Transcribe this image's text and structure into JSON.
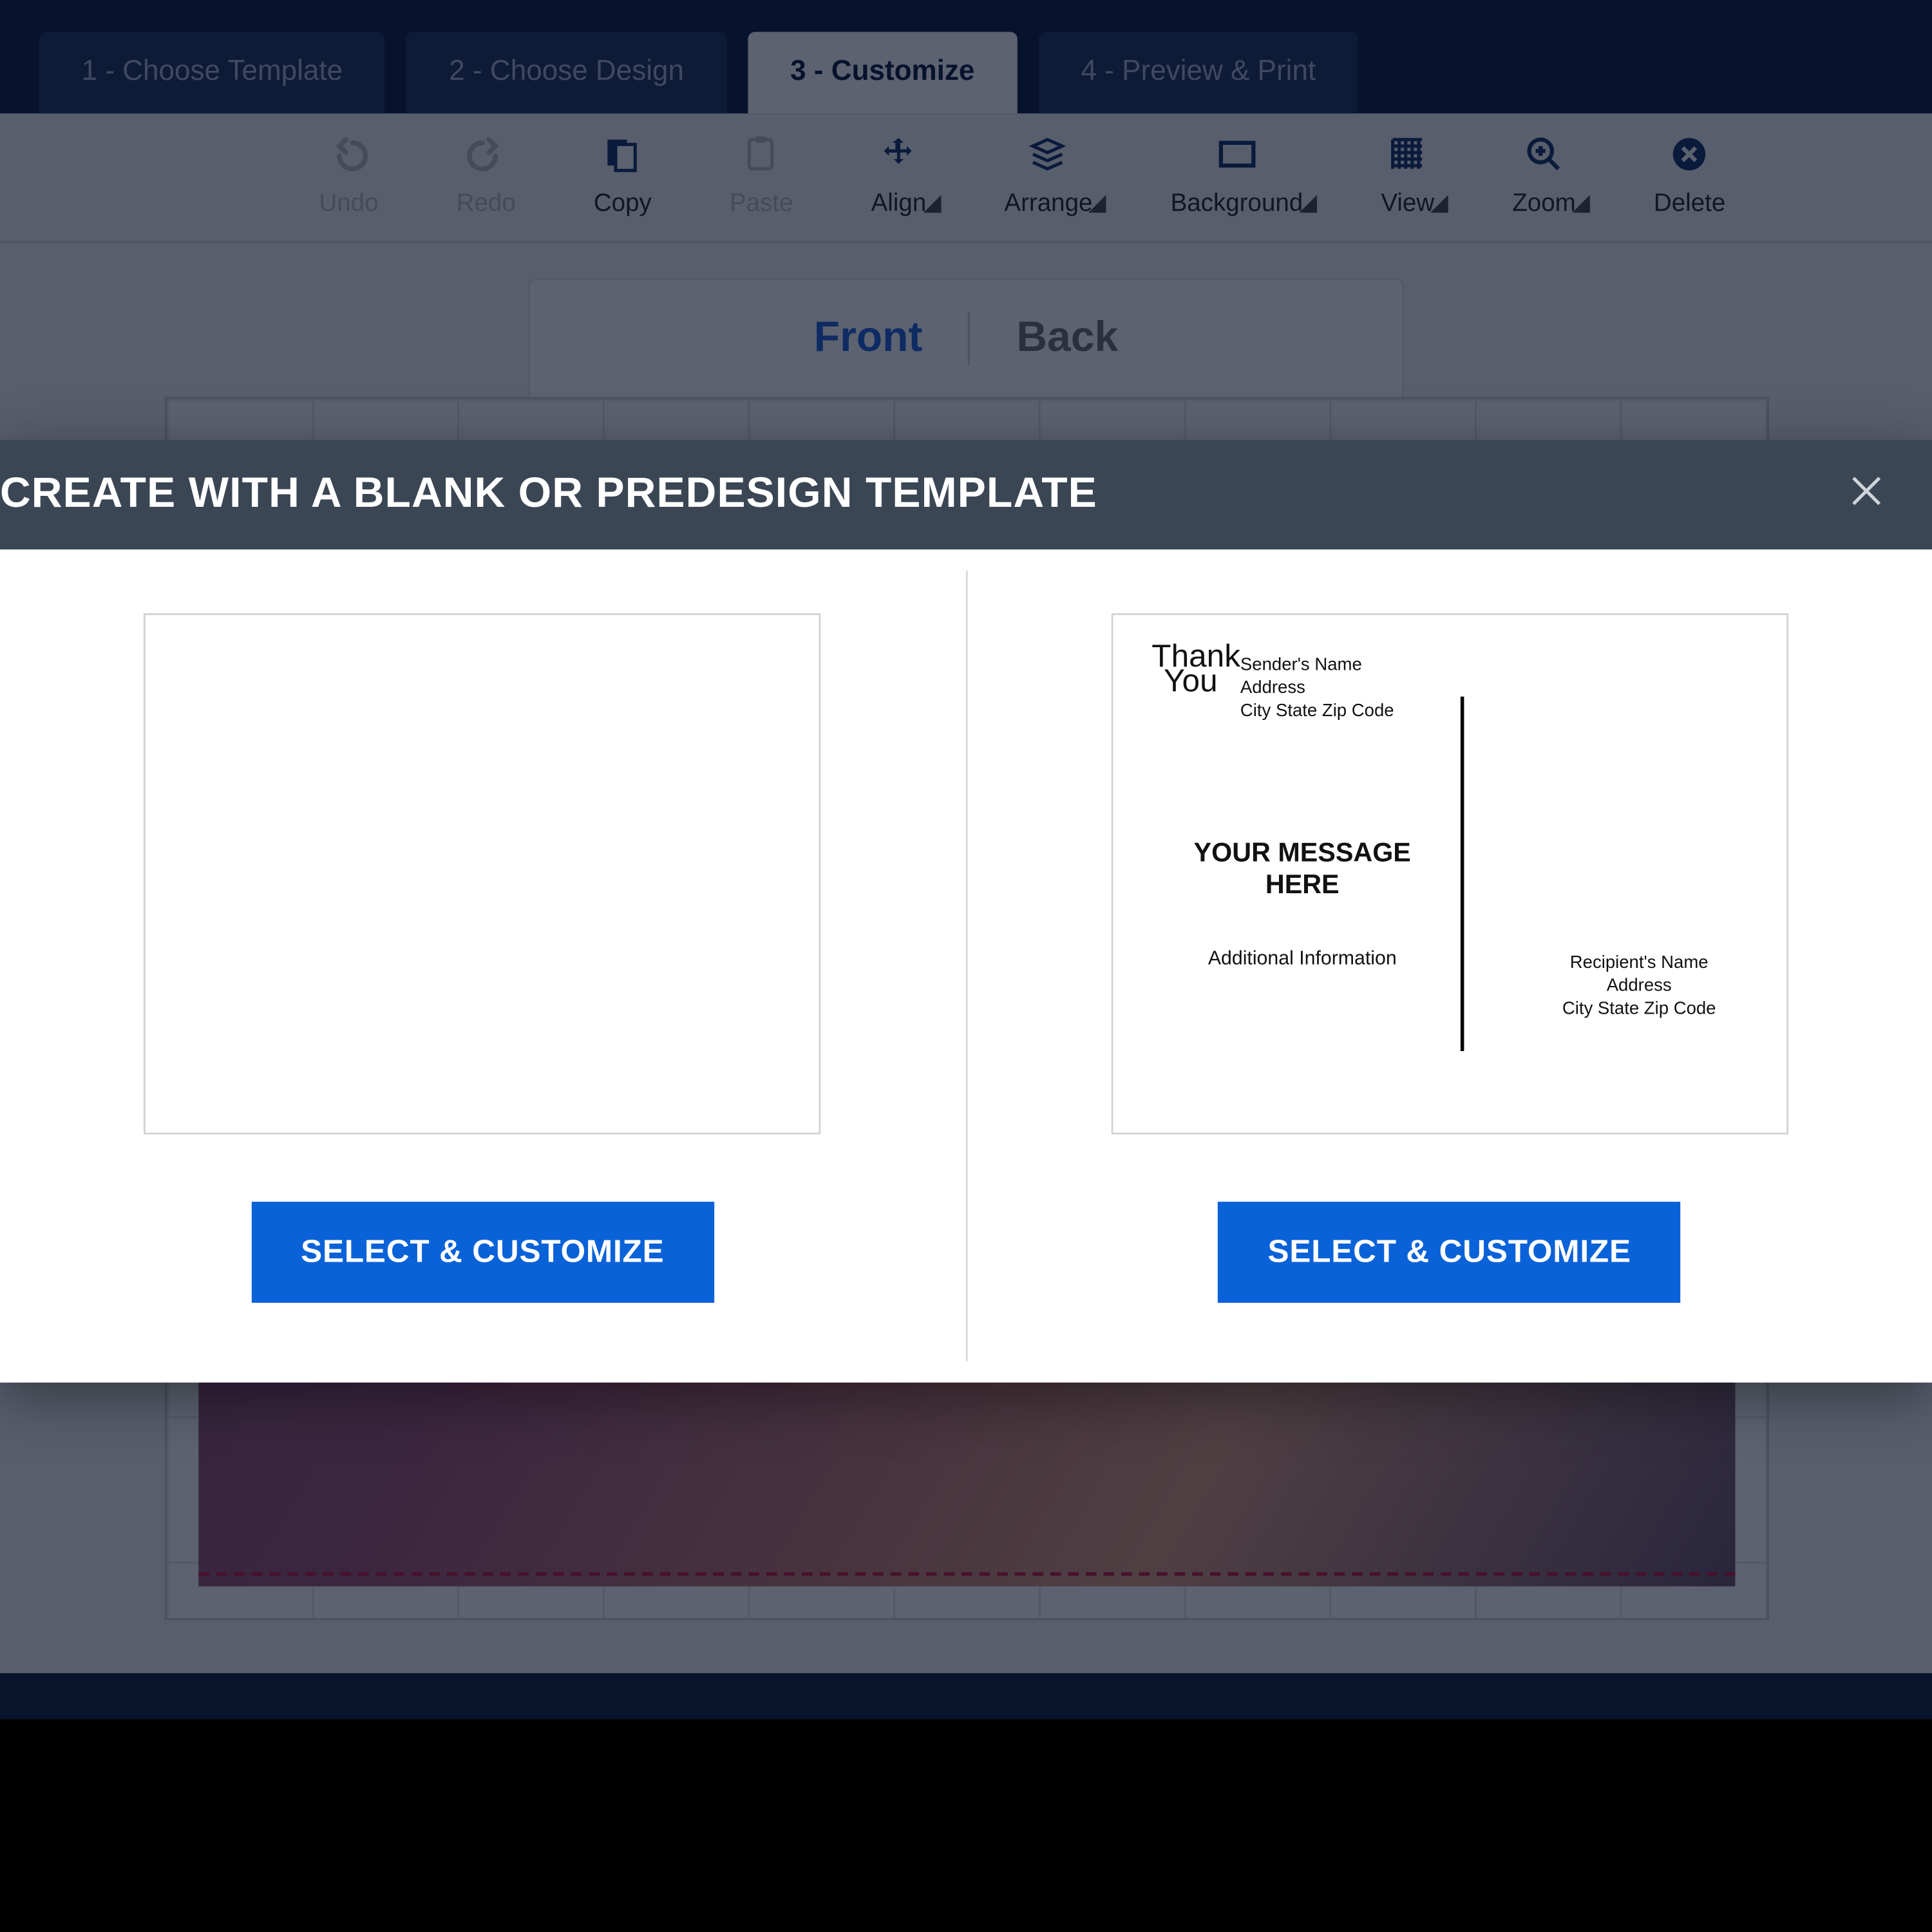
{
  "wizard": {
    "tabs": [
      {
        "label": "1 - Choose Template",
        "active": false
      },
      {
        "label": "2 - Choose Design",
        "active": false
      },
      {
        "label": "3 - Customize",
        "active": true
      },
      {
        "label": "4 - Preview & Print",
        "active": false
      }
    ]
  },
  "toolbar": {
    "undo": "Undo",
    "redo": "Redo",
    "copy": "Copy",
    "paste": "Paste",
    "align": "Align",
    "arrange": "Arrange",
    "background": "Background",
    "view": "View",
    "zoom": "Zoom",
    "delete": "Delete"
  },
  "sidetabs": {
    "front": "Front",
    "back": "Back"
  },
  "modal": {
    "title": "CREATE WITH A BLANK OR PREDESIGN TEMPLATE",
    "select_label": "SELECT & CUSTOMIZE",
    "predesign": {
      "thank1": "Thank",
      "thank2": "You",
      "sender_name": "Sender's Name",
      "sender_addr": "Address",
      "sender_csz": "City State Zip Code",
      "message_l1": "YOUR MESSAGE",
      "message_l2": "HERE",
      "additional": "Additional Information",
      "recip_name": "Recipient's Name",
      "recip_addr": "Address",
      "recip_csz": "City State Zip Code"
    }
  }
}
